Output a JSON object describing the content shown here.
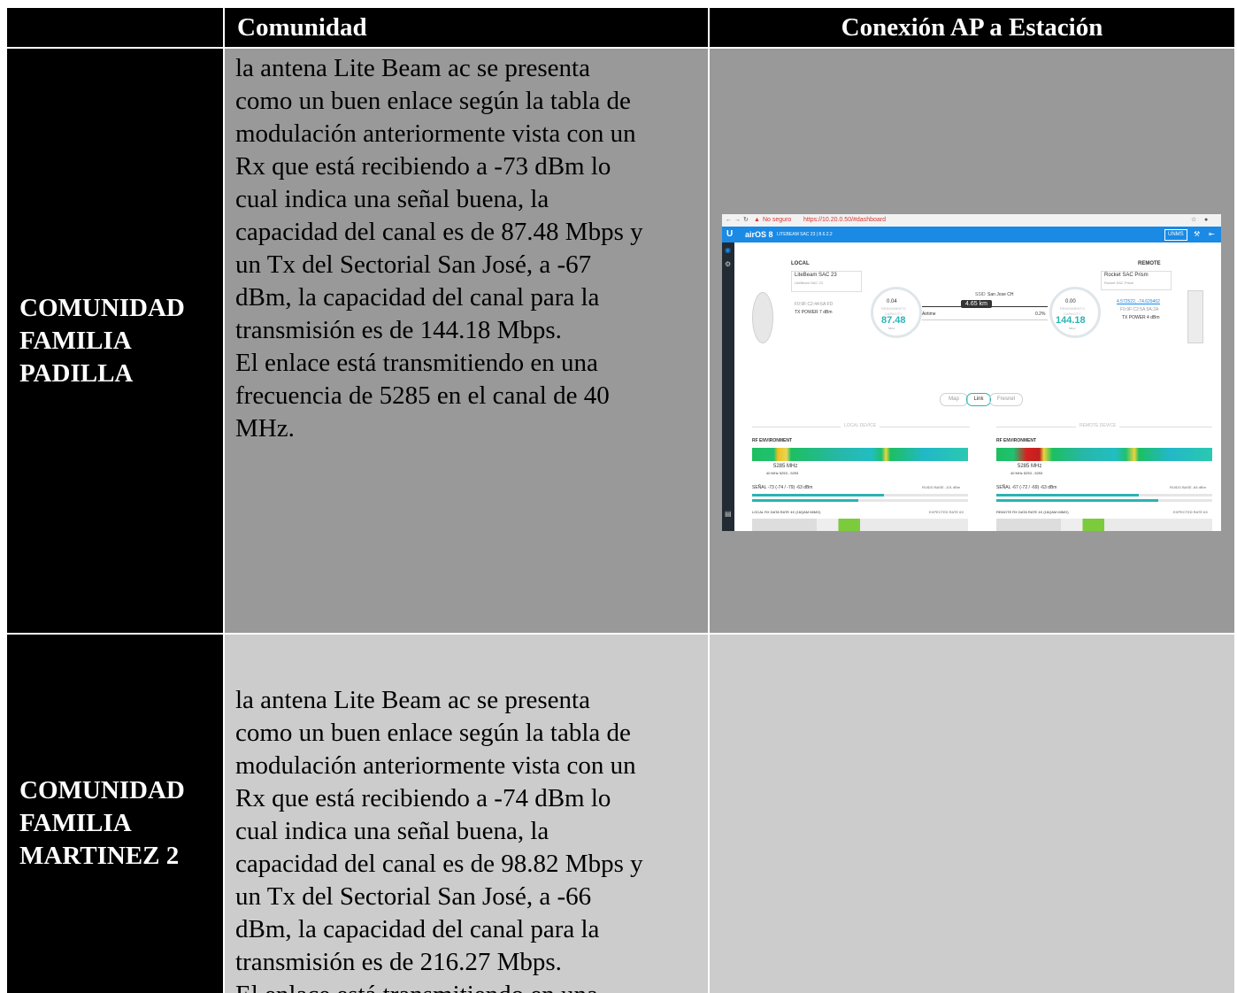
{
  "table": {
    "headers": [
      "",
      "Comunidad",
      "Conexión AP a Estación"
    ],
    "rows": [
      {
        "name_lines": [
          "COMUNIDAD",
          "FAMILIA",
          "PADILLA"
        ],
        "text_lines": [
          "la antena Lite Beam ac se presenta",
          "como un buen enlace según la tabla de",
          "modulación anteriormente vista con un",
          "Rx que está recibiendo a -73 dBm lo",
          "cual indica una señal buena, la",
          "capacidad del canal es de 87.48 Mbps y",
          "un Tx del Sectorial San José, a -67",
          "dBm, la capacidad del canal para la",
          "transmisión es de 144.18 Mbps.",
          "El enlace está transmitiendo en una",
          "frecuencia de 5285 en el canal de 40",
          "MHz."
        ]
      },
      {
        "name_lines": [
          "COMUNIDAD",
          "FAMILIA",
          "MARTINEZ 2"
        ],
        "text_lines": [
          "la antena Lite Beam ac se presenta",
          "como un buen enlace según la tabla de",
          "modulación anteriormente vista con un",
          "Rx que está recibiendo a -74 dBm lo",
          "cual indica una señal buena, la",
          "capacidad del canal es de 98.82 Mbps y",
          "un Tx del Sectorial San José, a -66",
          "dBm, la capacidad del canal para la",
          "transmisión es de 216.27 Mbps.",
          "El enlace está transmitiendo en una"
        ]
      }
    ]
  },
  "screenshot": {
    "address_warning": "No seguro",
    "url": "https://10.20.0.50/#dashboard",
    "app_logo": "U",
    "app_name": "airOS 8",
    "device_line": "LITEBEAM SAC 23 | 8.6.2.2",
    "unms_label": "UNMS",
    "local_label": "LOCAL",
    "remote_label": "REMOTE",
    "local_device_name": "LiteBeam SAC 23",
    "local_device_model": "LiteBeam SAC 23",
    "local_mac": "F0:9F:C2:44:6A:FD",
    "local_tx_power": "TX POWER 7 dBm",
    "remote_device_name": "Rocket SAC Prism",
    "remote_device_model": "Rocket SAC Prism",
    "remote_coords": "4.572522, -74.629402",
    "remote_mac": "F0:9F:C2:5A:9A:2A",
    "remote_tx_power": "TX POWER 4 dBm",
    "ssid_label": "SSID",
    "ssid_value": "San Jose CH",
    "distance": "4.65 km",
    "airtime_label": "Airtime",
    "airtime_local": "0.2%",
    "local_rendimiento": "0.04",
    "remote_rendimiento": "0.00",
    "rendimiento_label": "RENDIMIENTO",
    "capacity_label": "CAPACITY",
    "local_capacity": "87.48",
    "remote_capacity": "144.18",
    "unit_mbps": "Mbps",
    "view_tabs": [
      "Map",
      "Link",
      "Fresnel"
    ],
    "local_device_label": "LOCAL DEVICE",
    "remote_device_label": "REMOTE DEVICE",
    "rf_environment": "RF ENVIRONMENT",
    "freq": "5285 MHz",
    "channel_local": "40 MHz 5253 - 5293",
    "channel_remote": "40 MHz 5253 - 5293",
    "signal_local": "SEÑAL -73 (-74 / -79) -63 dBm",
    "signal_remote": "SEÑAL -67 (-72 / -69) -63 dBm",
    "noise_local": "RUIDO BASE -101 dBm",
    "noise_remote": "RUIDO BASE -84 dBm",
    "rx_rate_local": "LOCAL RX DATA RATE 4X (16QAM MIMO)",
    "rx_rate_remote": "REMOTE RX DATA RATE 4X (16QAM MIMO)",
    "expected_rate": "EXPECTED RATE 6X"
  },
  "colors": {
    "header_bg": "#000000",
    "dark_cell": "#999999",
    "light_cell": "#cccccc",
    "airos_blue": "#1a8ae5",
    "capacity_teal": "#2bb3b4"
  }
}
